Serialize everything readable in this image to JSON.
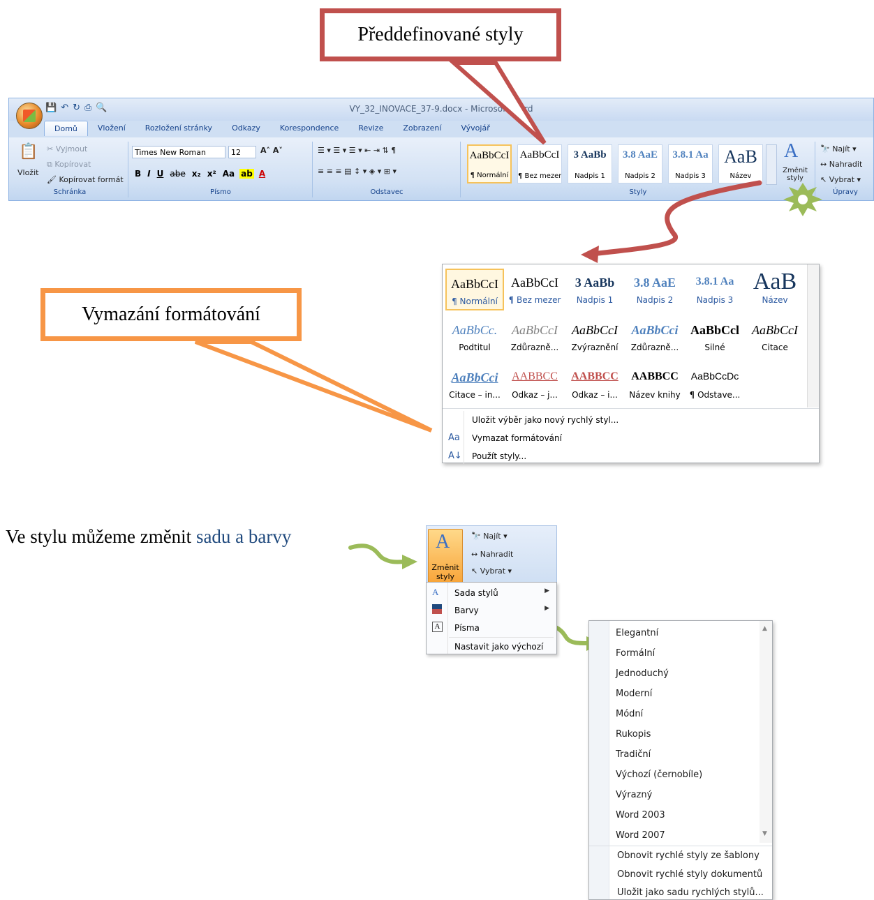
{
  "callouts": {
    "styles": "Předdefinované styly",
    "clear": "Vymazání formátování"
  },
  "ribbon": {
    "window_title": "VY_32_INOVACE_37-9.docx - Microsoft Word",
    "tabs": [
      "Domů",
      "Vložení",
      "Rozložení stránky",
      "Odkazy",
      "Korespondence",
      "Revize",
      "Zobrazení",
      "Vývojář"
    ],
    "clipboard": {
      "paste": "Vložit",
      "cut": "Vyjmout",
      "copy": "Kopírovat",
      "format_painter": "Kopírovat formát",
      "label": "Schránka"
    },
    "font": {
      "name": "Times New Roman",
      "size": "12",
      "label": "Písmo",
      "bold": "B",
      "italic": "I",
      "underline": "U",
      "strike": "abe",
      "subscript": "x₂",
      "superscript": "x²",
      "case": "Aa"
    },
    "paragraph": {
      "label": "Odstavec"
    },
    "styles_label": "Styly",
    "style_cards": [
      {
        "sample": "AaBbCcI",
        "name": "¶ Normální"
      },
      {
        "sample": "AaBbCcI",
        "name": "¶ Bez mezer"
      },
      {
        "sample": "3 AaBb",
        "name": "Nadpis 1"
      },
      {
        "sample": "3.8 AaE",
        "name": "Nadpis 2"
      },
      {
        "sample": "3.8.1 Aa",
        "name": "Nadpis 3"
      },
      {
        "sample": "AaB",
        "name": "Název"
      }
    ],
    "change_styles": "Změnit styly",
    "editing": {
      "find": "Najít",
      "replace": "Nahradit",
      "select": "Vybrat",
      "label": "Úpravy"
    }
  },
  "gallery": {
    "rows": [
      [
        {
          "sample": "AaBbCcI",
          "name": "¶ Normální"
        },
        {
          "sample": "AaBbCcI",
          "name": "¶ Bez mezer"
        },
        {
          "sample": "3 AaBb",
          "name": "Nadpis 1"
        },
        {
          "sample": "3.8 AaE",
          "name": "Nadpis 2"
        },
        {
          "sample": "3.8.1 Aa",
          "name": "Nadpis 3"
        },
        {
          "sample": "AaB",
          "name": "Název"
        }
      ],
      [
        {
          "sample": "AaBbCc.",
          "name": "Podtitul"
        },
        {
          "sample": "AaBbCcI",
          "name": "Zdůrazně..."
        },
        {
          "sample": "AaBbCcI",
          "name": "Zvýraznění"
        },
        {
          "sample": "AaBbCci",
          "name": "Zdůrazně..."
        },
        {
          "sample": "AaBbCcl",
          "name": "Silné"
        },
        {
          "sample": "AaBbCcI",
          "name": "Citace"
        }
      ],
      [
        {
          "sample": "AaBbCci",
          "name": "Citace – in..."
        },
        {
          "sample": "AABBCC",
          "name": "Odkaz – j..."
        },
        {
          "sample": "AABBCC",
          "name": "Odkaz – i..."
        },
        {
          "sample": "AABBCC",
          "name": "Název knihy"
        },
        {
          "sample": "AaBbCcDc",
          "name": "¶ Odstave..."
        }
      ]
    ],
    "menu": [
      "Uložit výběr jako nový rychlý styl...",
      "Vymazat formátování",
      "Použít styly..."
    ]
  },
  "body_text": {
    "prefix": "Ve stylu můžeme změnit ",
    "highlight": "sadu a barvy"
  },
  "change_styles_panel": {
    "button": "Změnit styly",
    "find": "Najít",
    "replace": "Nahradit",
    "select": "Vybrat",
    "menu": [
      "Sada stylů",
      "Barvy",
      "Písma",
      "Nastavit jako výchozí"
    ]
  },
  "font_sets": {
    "items": [
      "Elegantní",
      "Formální",
      "Jednoduchý",
      "Moderní",
      "Módní",
      "Rukopis",
      "Tradiční",
      "Výchozí (černobíle)",
      "Výrazný",
      "Word 2003",
      "Word 2007"
    ],
    "actions": [
      "Obnovit rychlé styly ze šablony",
      "Obnovit rychlé styly dokumentů",
      "Uložit jako sadu rychlých stylů..."
    ]
  }
}
